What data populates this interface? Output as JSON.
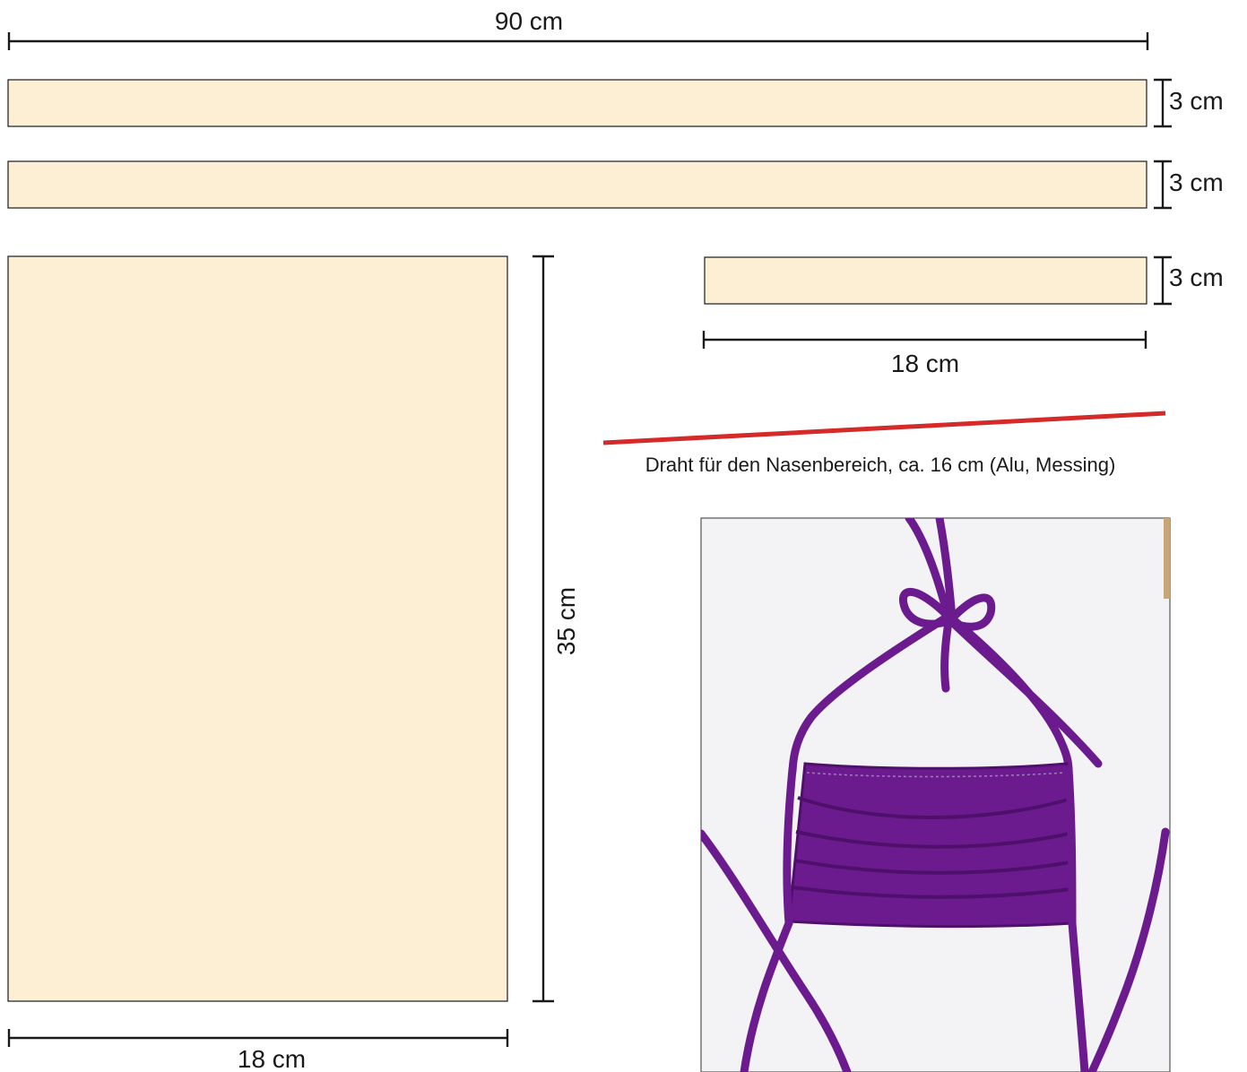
{
  "colors": {
    "fabric": "#fdefd3",
    "outline": "#1a1a1a",
    "wire": "#d42a2a",
    "mask_purple": "#6b1b8e",
    "mask_purple_dark": "#4e106b",
    "photo_background": "#f3f3f5"
  },
  "dimensions": {
    "long_strip_length": "90 cm",
    "strip_width_1": "3 cm",
    "strip_width_2": "3 cm",
    "strip_width_3": "3 cm",
    "short_strip_length": "18 cm",
    "main_piece_height": "35 cm",
    "main_piece_width": "18 cm"
  },
  "wire": {
    "caption": "Draht für den Nasenbereich, ca. 16 cm (Alu, Messing)"
  },
  "photo": {
    "subject": "purple-fabric-face-mask-with-ties"
  }
}
